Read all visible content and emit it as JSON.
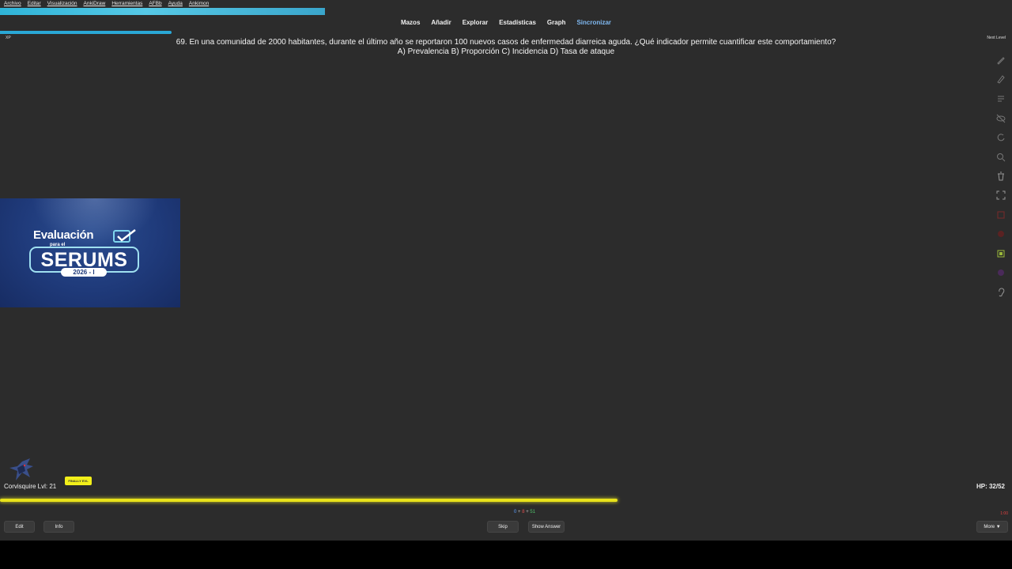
{
  "menu": [
    "Archivo",
    "Editar",
    "Visualización",
    "AnkiDraw",
    "Herramientas",
    "AFBb",
    "Ayuda",
    "Ankimon"
  ],
  "nav": {
    "decks": "Mazos",
    "add": "Añadir",
    "browse": "Explorar",
    "stats": "Estadísticas",
    "graph": "Graph",
    "sync": "Sincronizar"
  },
  "xp": {
    "label": "XP",
    "progress": 0.17
  },
  "next_level": "Next Level",
  "card": {
    "question": "69. En una comunidad de 2000 habitantes, durante el último año se reportaron 100 nuevos casos de enfermedad diarreica aguda. ¿Qué indicador permite cuantificar este comportamiento?",
    "options": "A) Prevalencia B) Proporción C) Incidencia D) Tasa de ataque"
  },
  "banner": {
    "line1": "Evaluación",
    "line2": "para el",
    "line3": "SERUMS",
    "line4": "2026 - I"
  },
  "pokemon": {
    "name": "Corvisquire Lvl: 21",
    "badge": "FINALLY EVL",
    "hp": "HP: 32/52",
    "hp_fraction": 0.61
  },
  "counts": {
    "new": "0",
    "sep1": " + ",
    "learn": "8",
    "sep2": " + ",
    "review": "51"
  },
  "indicator": "1:00",
  "buttons": {
    "edit": "Edit",
    "info": "Info",
    "skip": "Skip",
    "show_answer": "Show Answer",
    "more": "More ▼"
  },
  "tools": [
    "pen-icon",
    "pencil-icon",
    "lines-icon",
    "eye-off-icon",
    "rotate-icon",
    "zoom-icon",
    "trash-icon",
    "fullscreen-icon",
    "red-square-icon",
    "red-fill-icon",
    "green-square-icon",
    "purple-icon",
    "ear-icon"
  ],
  "colors": {
    "xp": "#2aa8d6",
    "hp": "#e8e21a",
    "sync": "#7fb8f0"
  }
}
